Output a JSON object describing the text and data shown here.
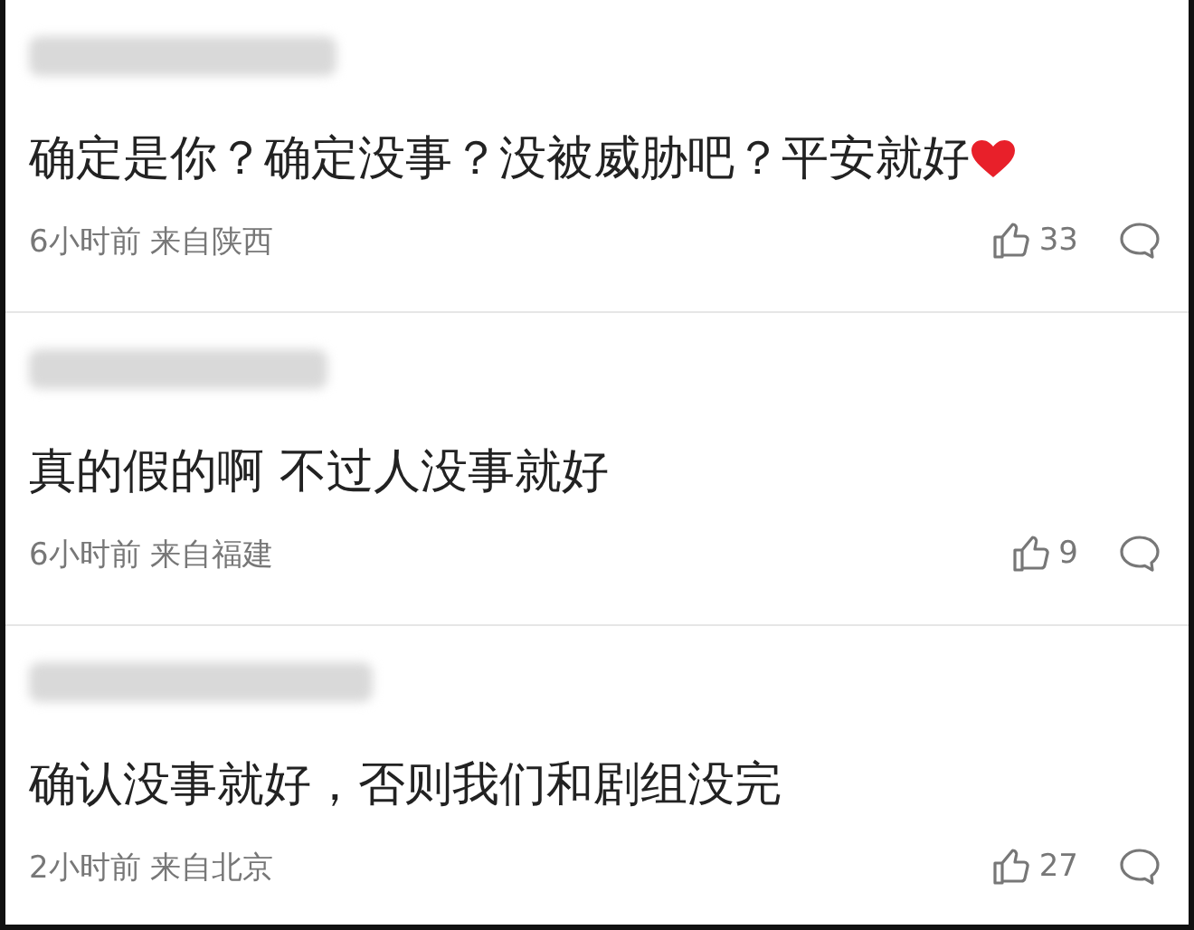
{
  "comments": [
    {
      "text": "确定是你？确定没事？没被威胁吧？平安就好",
      "heart": true,
      "meta": "6小时前 来自陕西",
      "likes": "33"
    },
    {
      "text": "真的假的啊 不过人没事就好",
      "heart": false,
      "meta": "6小时前 来自福建",
      "likes": "9"
    },
    {
      "text": "确认没事就好，否则我们和剧组没完",
      "heart": false,
      "meta": "2小时前 来自北京",
      "likes": "27"
    }
  ]
}
